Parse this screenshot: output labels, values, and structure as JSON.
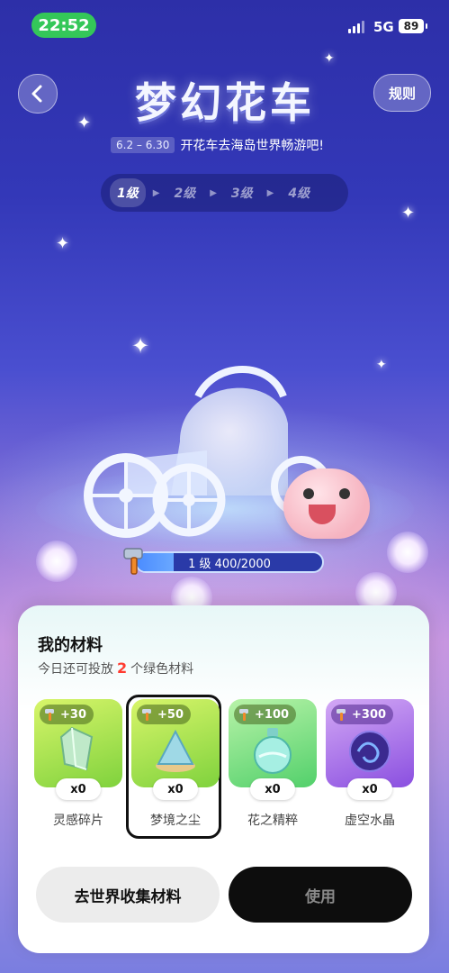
{
  "status_bar": {
    "time": "22:52",
    "network": "5G",
    "battery": "89"
  },
  "header": {
    "title": "梦幻花车",
    "date_range": "6.2 – 6.30",
    "subtitle": "开花车去海岛世界畅游吧!",
    "rules_label": "规则"
  },
  "levels": [
    {
      "label": "1级",
      "active": true
    },
    {
      "label": "2级",
      "active": false
    },
    {
      "label": "3级",
      "active": false
    },
    {
      "label": "4级",
      "active": false
    }
  ],
  "progress": {
    "text": "1 级 400/2000",
    "current": 400,
    "max": 2000
  },
  "panel": {
    "title": "我的材料",
    "desc_prefix": "今日还可投放",
    "desc_count": "2",
    "desc_suffix": "个绿色材料",
    "materials": [
      {
        "bonus": "+30",
        "count": "x0",
        "name": "灵感碎片",
        "color_top": "#c9f25a",
        "color_bottom": "#7fd23d",
        "icon": "crystal-shard-icon"
      },
      {
        "bonus": "+50",
        "count": "x0",
        "name": "梦境之尘",
        "color_top": "#c9f25a",
        "color_bottom": "#7fd23d",
        "icon": "dream-dust-icon"
      },
      {
        "bonus": "+100",
        "count": "x0",
        "name": "花之精粹",
        "color_top": "#a8ef9a",
        "color_bottom": "#52d06b",
        "icon": "flower-essence-icon"
      },
      {
        "bonus": "+300",
        "count": "x0",
        "name": "虚空水晶",
        "color_top": "#c99cf2",
        "color_bottom": "#8a4fe0",
        "icon": "void-crystal-icon"
      }
    ],
    "collect_button": "去世界收集材料",
    "use_button": "使用"
  }
}
